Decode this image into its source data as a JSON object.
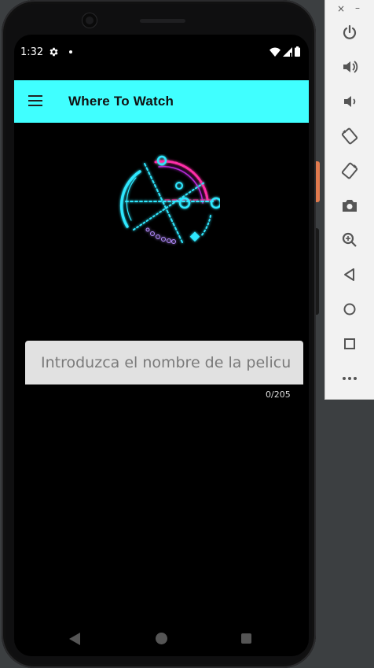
{
  "status_bar": {
    "time": "1:32",
    "icons": [
      "gear-icon",
      "dot-icon",
      "wifi-icon",
      "signal-icon",
      "battery-icon"
    ]
  },
  "toolbar": {
    "title": "Where To Watch",
    "menu_icon": "menu-icon",
    "background": "#40ffff"
  },
  "logo": {
    "icon": "neon-compass-logo",
    "colors": [
      "#2fe8ff",
      "#ff2fa8"
    ]
  },
  "search": {
    "placeholder": "Introduzca el nombre de la pelicula",
    "value": "",
    "counter": "0/205"
  },
  "nav_bar": {
    "items": [
      "back-icon",
      "home-icon",
      "recents-icon"
    ]
  },
  "emulator_panel": {
    "window_controls": [
      "×",
      "–"
    ],
    "buttons": [
      "power-icon",
      "volume-up-icon",
      "volume-down-icon",
      "rotate-left-icon",
      "rotate-right-icon",
      "camera-icon",
      "zoom-icon",
      "back-icon",
      "home-icon",
      "overview-icon",
      "more-icon"
    ]
  }
}
